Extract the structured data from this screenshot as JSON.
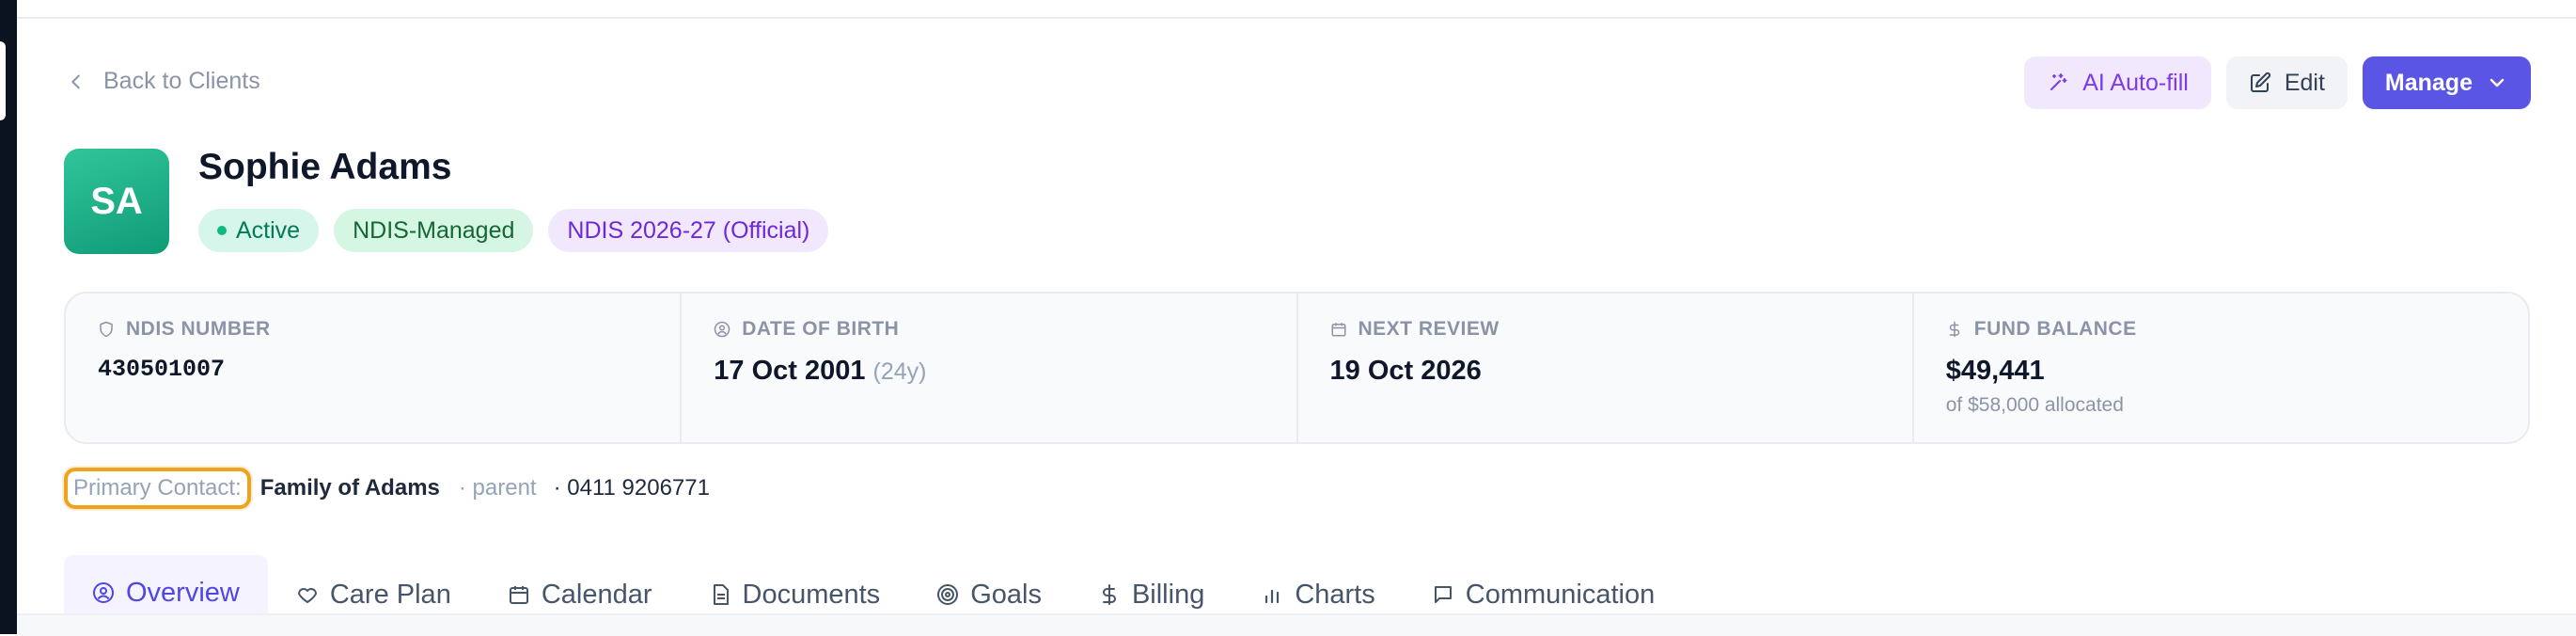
{
  "back_link": {
    "label": "Back to Clients"
  },
  "actions": {
    "ai_autofill": "AI Auto-fill",
    "edit": "Edit",
    "manage": "Manage"
  },
  "client": {
    "initials": "SA",
    "name": "Sophie Adams",
    "badges": {
      "status": "Active",
      "management": "NDIS-Managed",
      "plan": "NDIS 2026-27 (Official)"
    }
  },
  "info": {
    "ndis_number": {
      "label": "NDIS NUMBER",
      "value": "430501007",
      "icon": "shield-icon"
    },
    "date_of_birth": {
      "label": "DATE OF BIRTH",
      "value": "17 Oct 2001",
      "age": "(24y)",
      "icon": "user-circle-icon"
    },
    "next_review": {
      "label": "NEXT REVIEW",
      "value": "19 Oct 2026",
      "icon": "calendar-icon"
    },
    "fund_balance": {
      "label": "FUND BALANCE",
      "value": "$49,441",
      "sub": "of $58,000 allocated",
      "icon": "dollar-icon"
    }
  },
  "primary_contact": {
    "label": "Primary Contact:",
    "name": "Family of Adams",
    "role": "· parent",
    "phone": "· 0411 9206771"
  },
  "tabs": [
    {
      "label": "Overview",
      "icon": "user-circle-icon",
      "active": true
    },
    {
      "label": "Care Plan",
      "icon": "heart-icon"
    },
    {
      "label": "Calendar",
      "icon": "calendar-icon"
    },
    {
      "label": "Documents",
      "icon": "document-icon"
    },
    {
      "label": "Goals",
      "icon": "target-icon"
    },
    {
      "label": "Billing",
      "icon": "dollar-icon"
    },
    {
      "label": "Charts",
      "icon": "bar-chart-icon"
    },
    {
      "label": "Communication",
      "icon": "message-icon"
    }
  ],
  "colors": {
    "accent": "#5b55e6",
    "active_green": "#10b981",
    "ai_purple": "#7c3aed",
    "highlight_orange": "#f0a21b"
  }
}
